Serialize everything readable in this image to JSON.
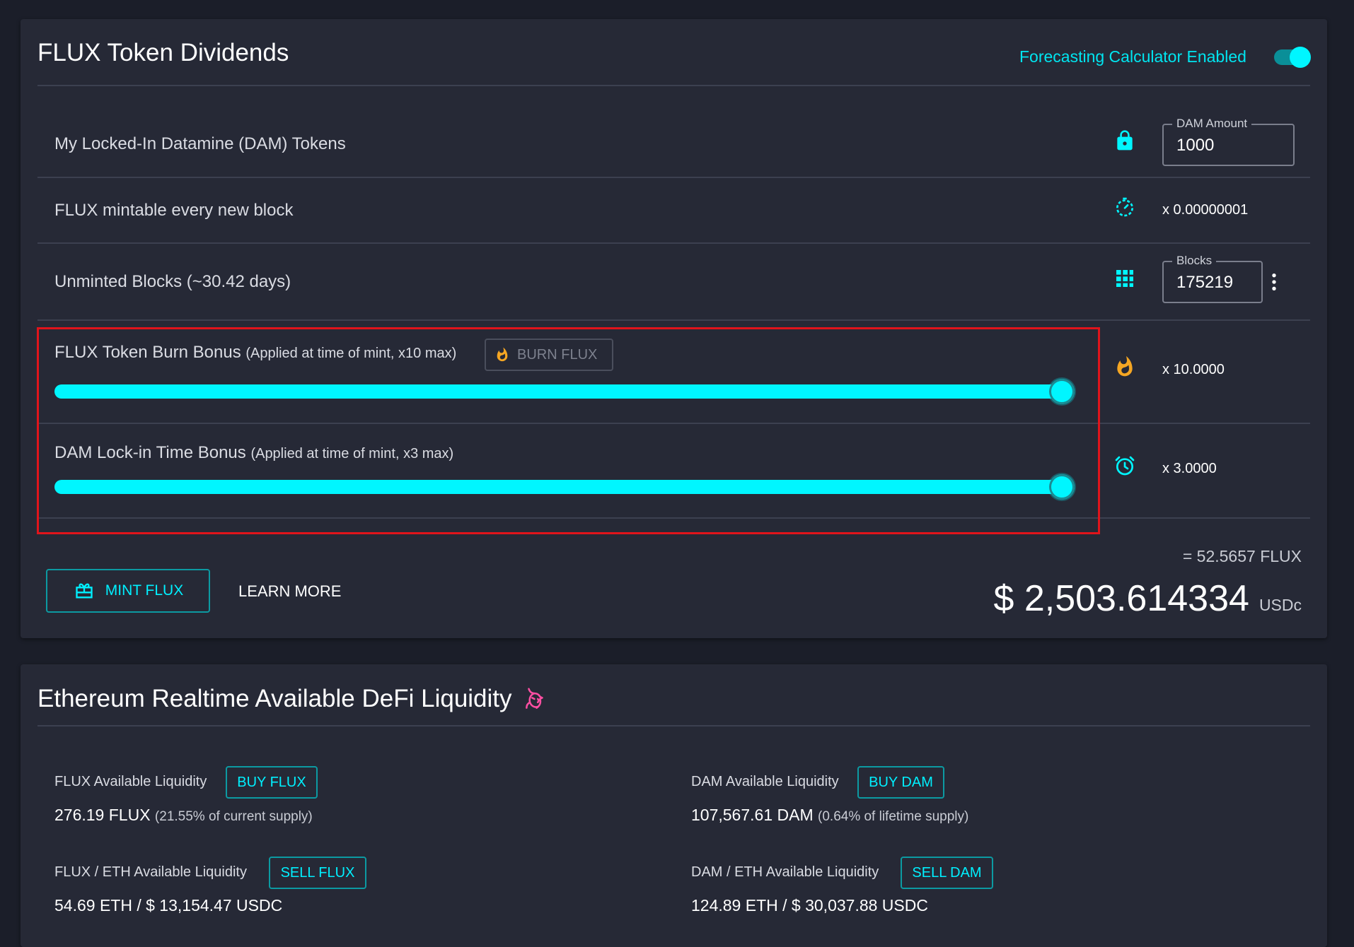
{
  "dividends": {
    "title": "FLUX Token Dividends",
    "forecast_label": "Forecasting Calculator Enabled",
    "forecast_enabled": true,
    "rows": {
      "locked": {
        "label": "My Locked-In Datamine (DAM) Tokens",
        "field_legend": "DAM Amount",
        "field_value": "1000",
        "icon": "lock-icon"
      },
      "mintable": {
        "label": "FLUX mintable every new block",
        "value": "x 0.00000001",
        "icon": "timer-icon"
      },
      "unminted": {
        "label": "Unminted Blocks (~30.42 days)",
        "field_legend": "Blocks",
        "field_value": "175219",
        "icon": "grid-icon"
      },
      "burn": {
        "label": "FLUX Token Burn Bonus",
        "sub": "(Applied at time of mint, x10 max)",
        "button": "BURN FLUX",
        "value": "x 10.0000",
        "slider_fraction": 1.0,
        "icon": "fire-icon"
      },
      "lock_time": {
        "label": "DAM Lock-in Time Bonus",
        "sub": "(Applied at time of mint, x3 max)",
        "value": "x 3.0000",
        "slider_fraction": 1.0,
        "icon": "alarm-icon"
      }
    },
    "mint_button": "MINT FLUX",
    "learn_more": "LEARN MORE",
    "flux_total": "= 52.5657 FLUX",
    "usd_total": "$ 2,503.614334",
    "usd_unit": "USDc"
  },
  "liquidity": {
    "title": "Ethereum Realtime Available DeFi Liquidity",
    "flux": {
      "label": "FLUX Available Liquidity",
      "button": "BUY FLUX",
      "value": "276.19 FLUX",
      "sub": "(21.55% of current supply)"
    },
    "dam": {
      "label": "DAM Available Liquidity",
      "button": "BUY DAM",
      "value": "107,567.61 DAM",
      "sub": "(0.64% of lifetime supply)"
    },
    "flux_eth": {
      "label": "FLUX / ETH Available Liquidity",
      "button": "SELL FLUX",
      "value": "54.69 ETH / $ 13,154.47 USDC"
    },
    "dam_eth": {
      "label": "DAM / ETH Available Liquidity",
      "button": "SELL DAM",
      "value": "124.89 ETH / $ 30,037.88 USDC"
    }
  },
  "colors": {
    "accent": "#00f6ff",
    "fire": "#f5a623",
    "highlight": "#e0141b",
    "unicorn": "#ff4fa3"
  }
}
